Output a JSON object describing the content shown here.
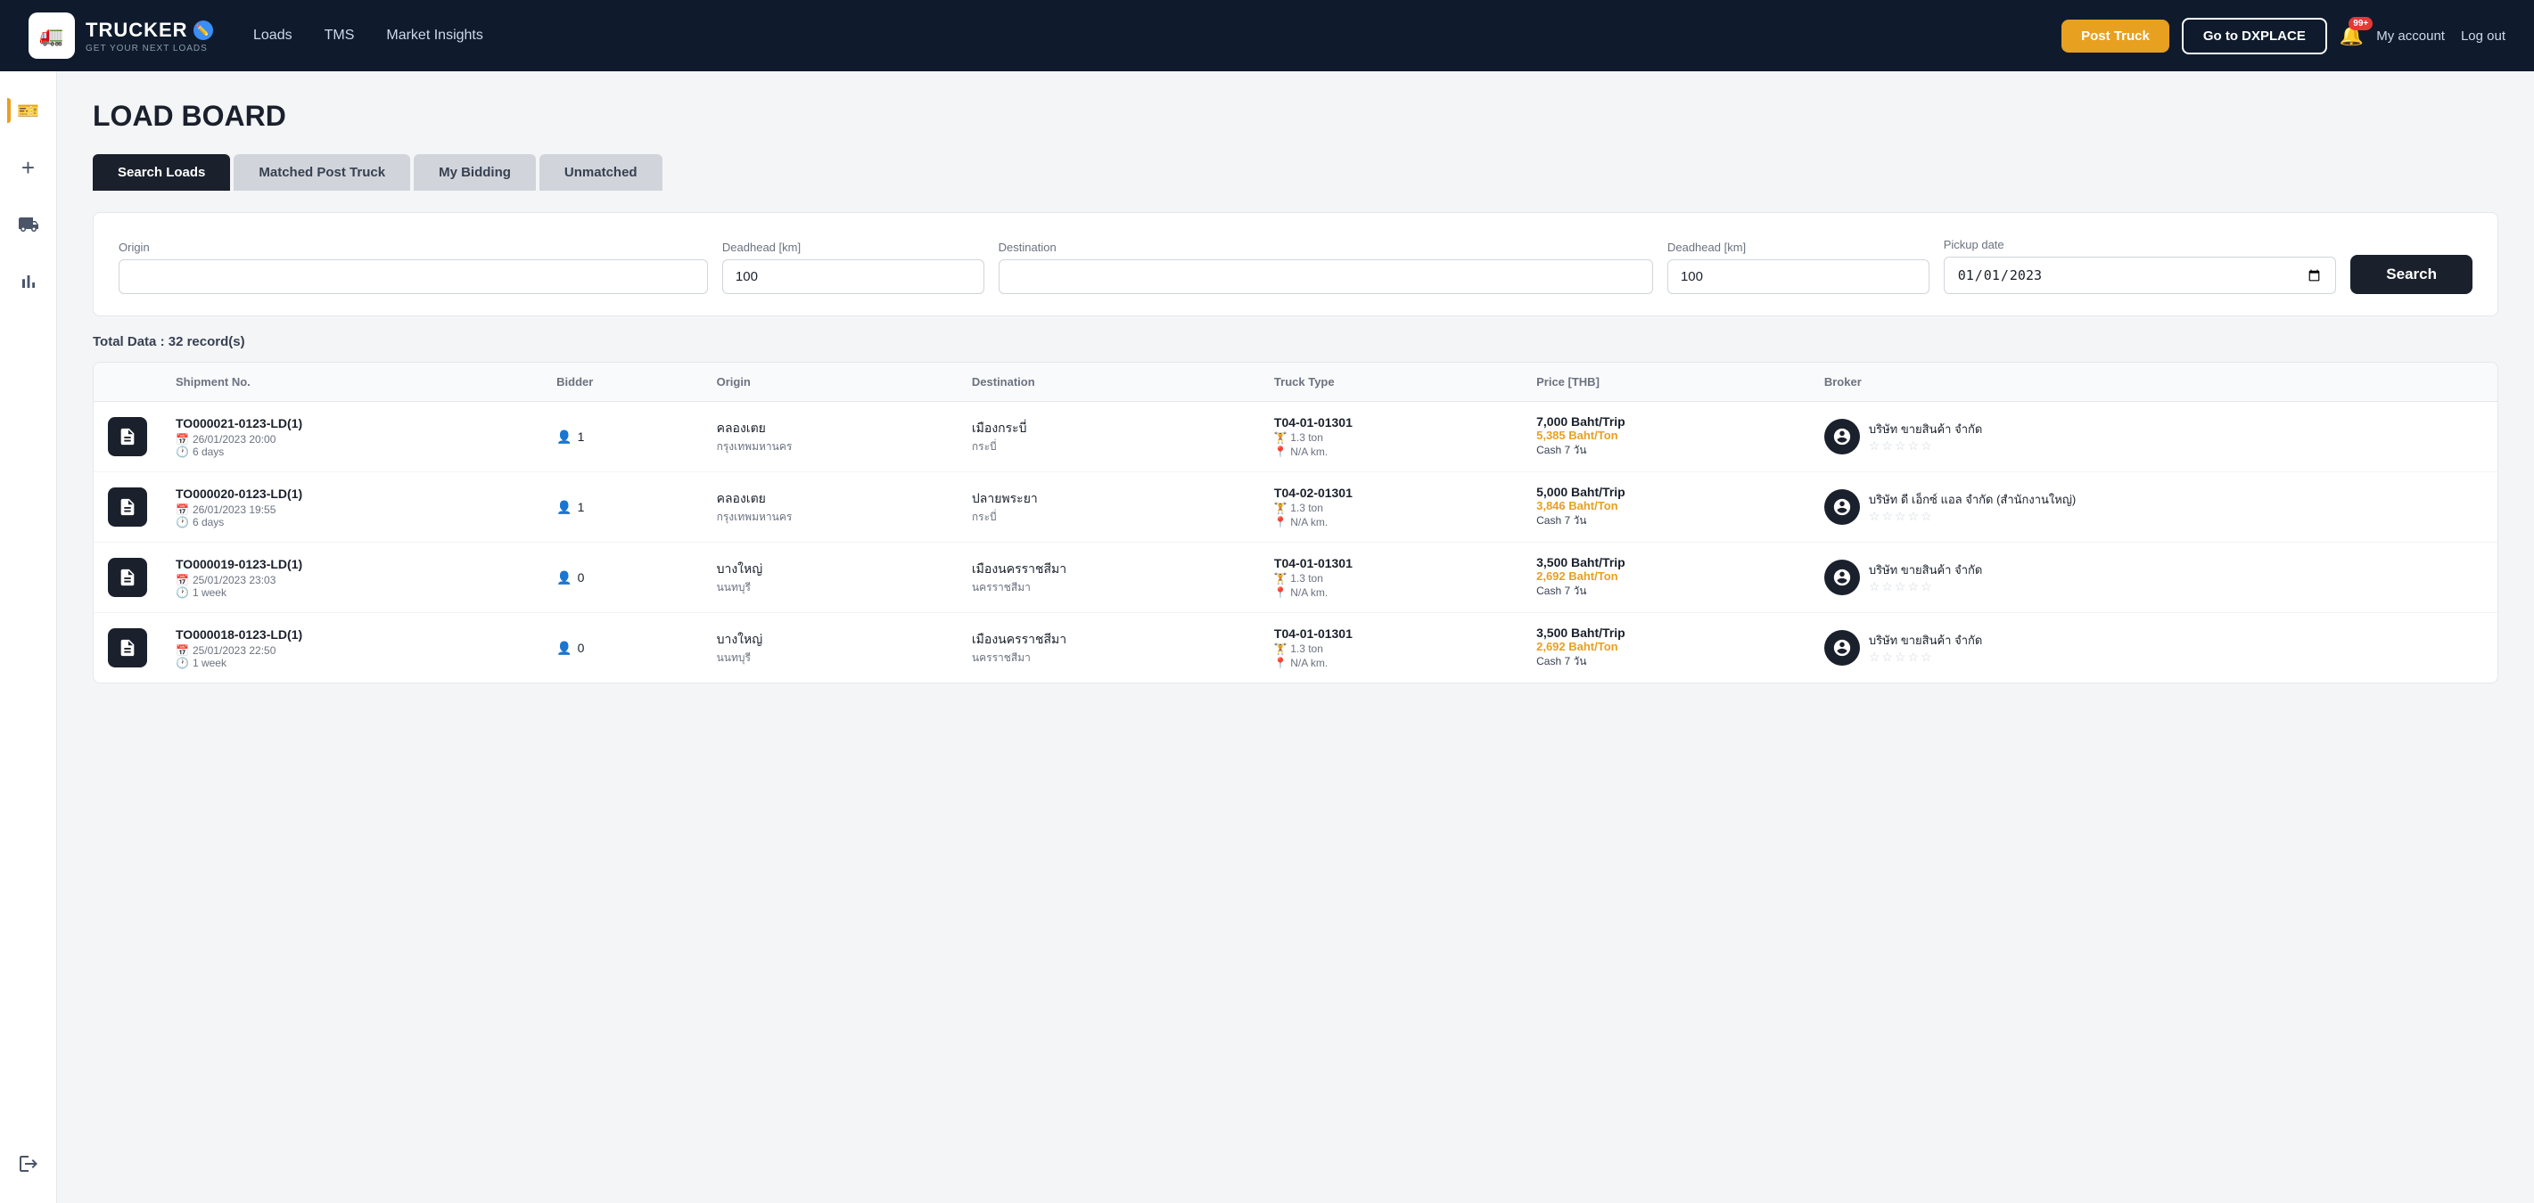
{
  "brand": {
    "name": "TRUCKER",
    "tagline": "GET YOUR NEXT LOADS",
    "icon": "🚛"
  },
  "topnav": {
    "links": [
      {
        "id": "loads",
        "label": "Loads"
      },
      {
        "id": "tms",
        "label": "TMS"
      },
      {
        "id": "market-insights",
        "label": "Market Insights"
      }
    ],
    "post_truck_label": "Post Truck",
    "go_dxplace_label": "Go to DXPLACE",
    "notification_count": "99+",
    "my_account_label": "My account",
    "logout_label": "Log out"
  },
  "sidebar": {
    "icons": [
      {
        "id": "loads-icon",
        "symbol": "🎫",
        "active": true
      },
      {
        "id": "add-icon",
        "symbol": "+",
        "active": false
      },
      {
        "id": "truck-icon",
        "symbol": "🚚",
        "active": false
      },
      {
        "id": "chart-icon",
        "symbol": "📊",
        "active": false
      },
      {
        "id": "logout-icon",
        "symbol": "🚪",
        "active": false
      }
    ]
  },
  "page": {
    "title": "LOAD BOARD"
  },
  "tabs": [
    {
      "id": "search-loads",
      "label": "Search Loads",
      "active": true
    },
    {
      "id": "matched-post-truck",
      "label": "Matched Post Truck",
      "active": false
    },
    {
      "id": "my-bidding",
      "label": "My Bidding",
      "active": false
    },
    {
      "id": "unmatched",
      "label": "Unmatched",
      "active": false
    }
  ],
  "search": {
    "origin_label": "Origin",
    "origin_placeholder": "",
    "deadhead1_label": "Deadhead [km]",
    "deadhead1_value": "100",
    "destination_label": "Destination",
    "destination_placeholder": "",
    "deadhead2_label": "Deadhead [km]",
    "deadhead2_value": "100",
    "pickup_label": "Pickup date",
    "pickup_value": "01/01/2023",
    "search_button": "Search"
  },
  "total_data": {
    "label": "Total Data :",
    "count": "32",
    "unit": "record(s)"
  },
  "table": {
    "columns": [
      "",
      "Shipment No.",
      "Bidder",
      "Origin",
      "Destination",
      "Truck Type",
      "Price [THB]",
      "Broker"
    ],
    "rows": [
      {
        "shipment_no": "TO000021-0123-LD(1)",
        "date": "26/01/2023 20:00",
        "duration": "6 days",
        "bidder_count": "1",
        "origin": "คลองเตย",
        "origin_sub": "กรุงเทพมหานคร",
        "destination": "เมืองกระบี่",
        "destination_sub": "กระบี่",
        "truck_type": "T04-01-01301",
        "truck_ton": "1.3 ton",
        "truck_km": "N/A km.",
        "price_main": "7,000 Baht/Trip",
        "price_per_ton": "5,385 Baht/Ton",
        "price_terms": "Cash 7 วัน",
        "broker_name": "บริษัท ขายสินค้า จำกัด",
        "broker_stars": "☆☆☆☆☆"
      },
      {
        "shipment_no": "TO000020-0123-LD(1)",
        "date": "26/01/2023 19:55",
        "duration": "6 days",
        "bidder_count": "1",
        "origin": "คลองเตย",
        "origin_sub": "กรุงเทพมหานคร",
        "destination": "ปลายพระยา",
        "destination_sub": "กระบี่",
        "truck_type": "T04-02-01301",
        "truck_ton": "1.3 ton",
        "truck_km": "N/A km.",
        "price_main": "5,000 Baht/Trip",
        "price_per_ton": "3,846 Baht/Ton",
        "price_terms": "Cash 7 วัน",
        "broker_name": "บริษัท ดี เอ็กซ์ แอล จำกัด (สำนักงานใหญ่)",
        "broker_stars": "☆☆☆☆☆"
      },
      {
        "shipment_no": "TO000019-0123-LD(1)",
        "date": "25/01/2023 23:03",
        "duration": "1 week",
        "bidder_count": "0",
        "origin": "บางใหญ่",
        "origin_sub": "นนทบุรี",
        "destination": "เมืองนครราชสีมา",
        "destination_sub": "นครราชสีมา",
        "truck_type": "T04-01-01301",
        "truck_ton": "1.3 ton",
        "truck_km": "N/A km.",
        "price_main": "3,500 Baht/Trip",
        "price_per_ton": "2,692 Baht/Ton",
        "price_terms": "Cash 7 วัน",
        "broker_name": "บริษัท ขายสินค้า จำกัด",
        "broker_stars": "☆☆☆☆☆"
      },
      {
        "shipment_no": "TO000018-0123-LD(1)",
        "date": "25/01/2023 22:50",
        "duration": "1 week",
        "bidder_count": "0",
        "origin": "บางใหญ่",
        "origin_sub": "นนทบุรี",
        "destination": "เมืองนครราชสีมา",
        "destination_sub": "นครราชสีมา",
        "truck_type": "T04-01-01301",
        "truck_ton": "1.3 ton",
        "truck_km": "N/A km.",
        "price_main": "3,500 Baht/Trip",
        "price_per_ton": "2,692 Baht/Ton",
        "price_terms": "Cash 7 วัน",
        "broker_name": "บริษัท ขายสินค้า จำกัด",
        "broker_stars": "☆☆☆☆☆"
      }
    ]
  }
}
